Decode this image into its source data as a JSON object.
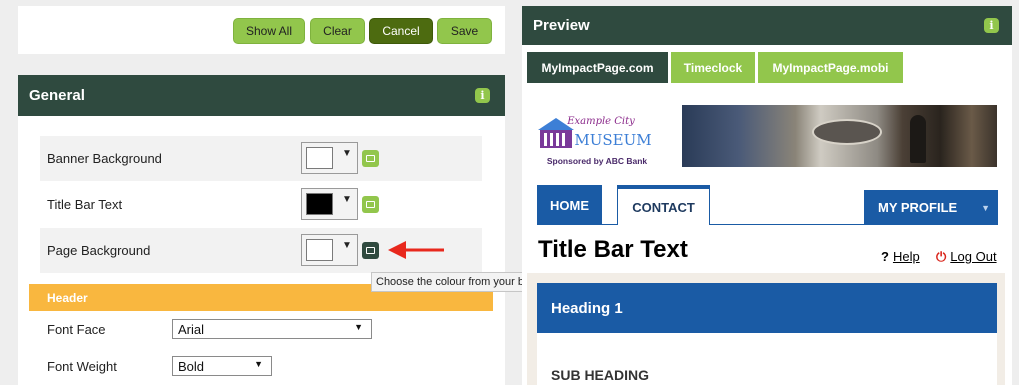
{
  "toolbar": {
    "show_all": "Show All",
    "clear": "Clear",
    "cancel": "Cancel",
    "save": "Save"
  },
  "general": {
    "title": "General",
    "info_icon": "i",
    "colors": [
      {
        "label": "Banner Background",
        "swatch": "#ffffff"
      },
      {
        "label": "Title Bar Text",
        "swatch": "#000000"
      },
      {
        "label": "Page Background",
        "swatch": "#ffffff"
      }
    ],
    "header_section": "Header",
    "font_face_label": "Font Face",
    "font_face_value": "Arial",
    "font_weight_label": "Font Weight",
    "font_weight_value": "Bold",
    "tooltip": "Choose the colour from your banner"
  },
  "preview": {
    "title": "Preview",
    "info_icon": "i",
    "tabs": [
      "MyImpactPage.com",
      "Timeclock",
      "MyImpactPage.mobi"
    ],
    "logo": {
      "line1": "Example City",
      "line2": "MUSEUM",
      "line3": "Sponsored by ABC Bank"
    },
    "nav": {
      "home": "HOME",
      "contact": "CONTACT",
      "profile": "MY PROFILE"
    },
    "title_bar_text": "Title Bar Text",
    "help_icon": "?",
    "help": "Help",
    "logout_icon": "⏻",
    "logout": "Log Out",
    "heading1": "Heading 1",
    "subheading": "SUB HEADING"
  },
  "colors": {
    "panel_header": "#2f4a3f",
    "accent_green": "#92c64c",
    "cancel_green": "#4d6b10",
    "header_orange": "#f9b73f",
    "nav_blue": "#1a5ba5",
    "arrow_red": "#e8281d"
  },
  "icons": {
    "info": "info-icon",
    "image": "image-icon",
    "dropdown": "caret-down-icon",
    "arrow": "red-arrow-icon"
  }
}
